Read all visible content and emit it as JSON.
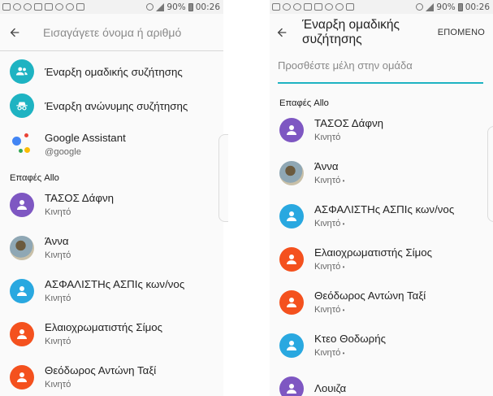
{
  "status_left": {
    "battery": "90%",
    "time": "00:26"
  },
  "status_right": {
    "battery": "90%",
    "time": "00:26"
  },
  "left": {
    "search_placeholder": "Εισαγάγετε όνομα ή αριθμό",
    "actions": [
      {
        "label": "Έναρξη ομαδικής συζήτησης",
        "icon": "group-add-icon"
      },
      {
        "label": "Έναρξη ανώνυμης συζήτησης",
        "icon": "incognito-icon"
      }
    ],
    "assistant": {
      "title": "Google Assistant",
      "subtitle": "@google"
    },
    "section_label": "Επαφές Allo",
    "contacts": [
      {
        "name": "ΤΑΣΟΣ Δάφνη",
        "sub": "Κινητό",
        "color": "#7e57c2",
        "photo": false
      },
      {
        "name": "Άννα",
        "sub": "Κινητό",
        "color": "#8fa7b4",
        "photo": true
      },
      {
        "name": "ΑΣΦΑΛΙΣΤΗς ΑΣΠΙς κων/νος",
        "sub": "Κινητό",
        "color": "#29a8e0",
        "photo": false
      },
      {
        "name": "Ελαιοχρωματιστής Σίμος",
        "sub": "Κινητό",
        "color": "#f4511e",
        "photo": false
      },
      {
        "name": "Θεόδωρος Αντώνη Ταξί",
        "sub": "Κινητό",
        "color": "#f4511e",
        "photo": false
      }
    ]
  },
  "right": {
    "title": "Έναρξη ομαδικής συζήτησης",
    "next_label": "ΕΠΟΜΕΝΟ",
    "member_placeholder": "Προσθέστε μέλη στην ομάδα",
    "section_label": "Επαφές Allo",
    "contacts": [
      {
        "name": "ΤΑΣΟΣ Δάφνη",
        "sub": "Κινητό",
        "color": "#7e57c2",
        "photo": false
      },
      {
        "name": "Άννα",
        "sub": "Κινητό",
        "color": "#8fa7b4",
        "photo": true
      },
      {
        "name": "ΑΣΦΑΛΙΣΤΗς ΑΣΠΙς κων/νος",
        "sub": "Κινητό",
        "color": "#29a8e0",
        "photo": false
      },
      {
        "name": "Ελαιοχρωματιστής Σίμος",
        "sub": "Κινητό",
        "color": "#f4511e",
        "photo": false
      },
      {
        "name": "Θεόδωρος Αντώνη Ταξί",
        "sub": "Κινητό",
        "color": "#f4511e",
        "photo": false
      },
      {
        "name": "Κτεο Θοδωρής",
        "sub": "Κινητό",
        "color": "#29a8e0",
        "photo": false
      },
      {
        "name": "Λουιζα",
        "sub": "",
        "color": "#7e57c2",
        "photo": false
      }
    ]
  },
  "colors": {
    "teal_accent": "#1eb3c2",
    "purple": "#7e57c2",
    "blue": "#29a8e0",
    "orange": "#f4511e"
  }
}
